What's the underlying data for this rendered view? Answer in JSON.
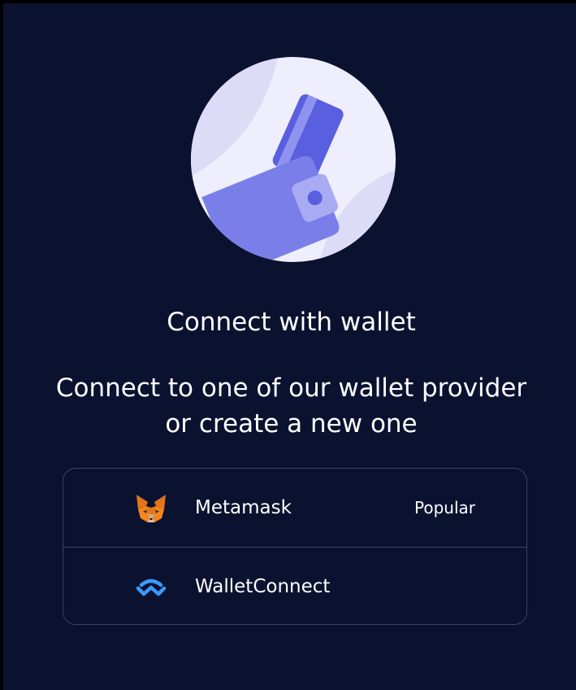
{
  "hero": {
    "icon": "wallet-illustration-icon"
  },
  "heading": {
    "title": "Connect with wallet"
  },
  "description": {
    "line1": "Connect to one of our wallet provider",
    "line2": "or create a new one"
  },
  "providers": [
    {
      "name": "Metamask",
      "badge": "Popular",
      "icon": "metamask-fox-icon"
    },
    {
      "name": "WalletConnect",
      "badge": "",
      "icon": "walletconnect-icon"
    }
  ],
  "colors": {
    "background": "#0b1230",
    "accent": "#6c6de8",
    "border": "#3a4360",
    "text": "#ffffff",
    "walletconnect_blue": "#3b99fc",
    "metamask_orange": "#e2761b"
  }
}
